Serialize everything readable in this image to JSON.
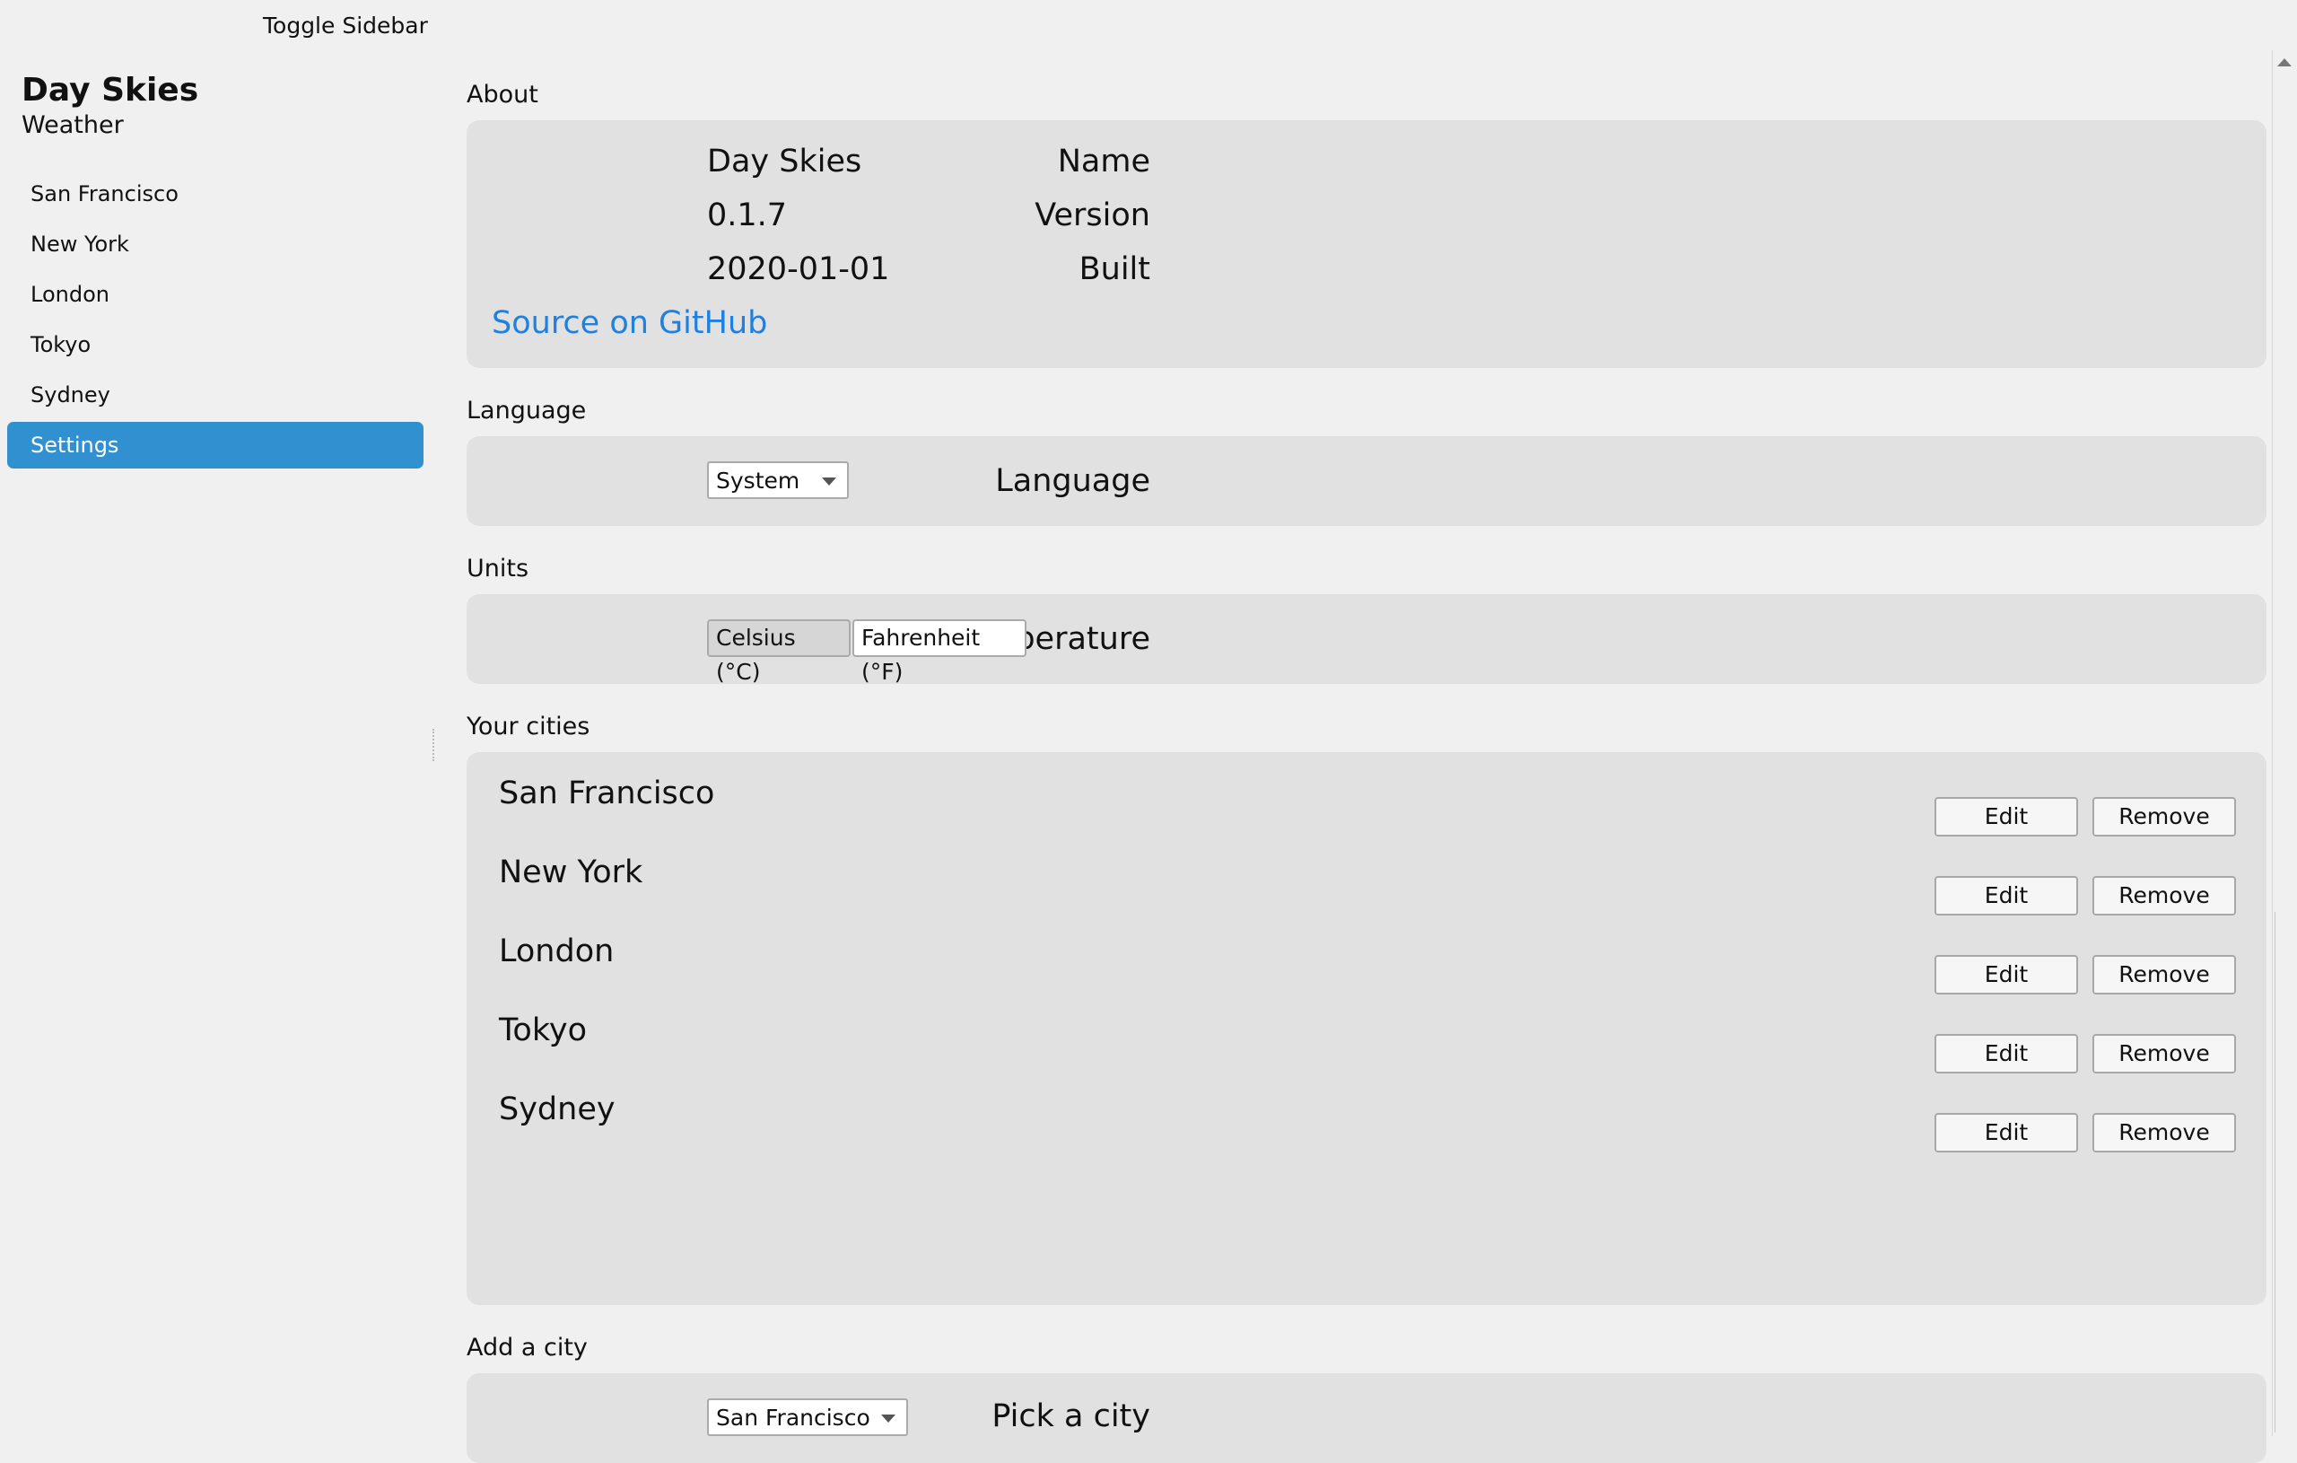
{
  "toolbar": {
    "toggle_label": "Toggle Sidebar"
  },
  "sidebar": {
    "title": "Day Skies",
    "subtitle": "Weather",
    "items": [
      {
        "label": "San Francisco"
      },
      {
        "label": "New York"
      },
      {
        "label": "London"
      },
      {
        "label": "Tokyo"
      },
      {
        "label": "Sydney"
      },
      {
        "label": "Settings",
        "active": true
      }
    ]
  },
  "about": {
    "heading": "About",
    "rows": [
      {
        "label": "Name",
        "value": "Day Skies"
      },
      {
        "label": "Version",
        "value": "0.1.7"
      },
      {
        "label": "Built",
        "value": "2020-01-01"
      }
    ],
    "link": "Source on GitHub"
  },
  "language": {
    "heading": "Language",
    "label": "Language",
    "selected": "System"
  },
  "units": {
    "heading": "Units",
    "label": "Temperature",
    "options": [
      "Celsius (°C)",
      "Fahrenheit (°F)"
    ],
    "selected": "Celsius (°C)"
  },
  "cities": {
    "heading": "Your cities",
    "list": [
      {
        "name": "San Francisco"
      },
      {
        "name": "New York"
      },
      {
        "name": "London"
      },
      {
        "name": "Tokyo"
      },
      {
        "name": "Sydney"
      }
    ],
    "edit_label": "Edit",
    "remove_label": "Remove"
  },
  "add_city": {
    "heading": "Add a city",
    "label": "Pick a city",
    "selected": "San Francisco"
  },
  "colors": {
    "accent": "#3090d0",
    "link": "#2080e0",
    "panel": "#e1e1e1",
    "background": "#f0f0f0"
  }
}
